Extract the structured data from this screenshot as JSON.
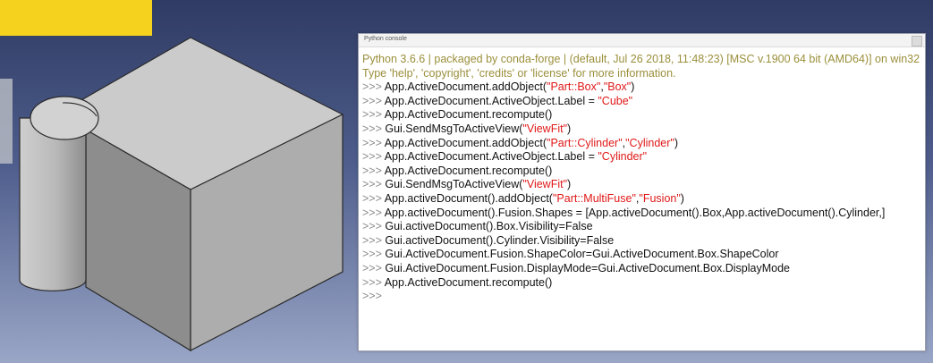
{
  "console": {
    "title": "Python console",
    "lines": [
      {
        "kind": "sys",
        "text": "Python 3.6.6 | packaged by conda-forge | (default, Jul 26 2018, 11:48:23) [MSC v.1900 64 bit (AMD64)] on win32"
      },
      {
        "kind": "sys",
        "text": "Type 'help', 'copyright', 'credits' or 'license' for more information."
      },
      {
        "kind": "cmd",
        "parts": [
          {
            "t": "code",
            "v": "App.ActiveDocument.addObject("
          },
          {
            "t": "str",
            "v": "\"Part::Box\""
          },
          {
            "t": "code",
            "v": ","
          },
          {
            "t": "str",
            "v": "\"Box\""
          },
          {
            "t": "code",
            "v": ")"
          }
        ]
      },
      {
        "kind": "cmd",
        "parts": [
          {
            "t": "code",
            "v": "App.ActiveDocument.ActiveObject.Label = "
          },
          {
            "t": "str",
            "v": "\"Cube\""
          }
        ]
      },
      {
        "kind": "cmd",
        "parts": [
          {
            "t": "code",
            "v": "App.ActiveDocument.recompute()"
          }
        ]
      },
      {
        "kind": "cmd",
        "parts": [
          {
            "t": "code",
            "v": "Gui.SendMsgToActiveView("
          },
          {
            "t": "str",
            "v": "\"ViewFit\""
          },
          {
            "t": "code",
            "v": ")"
          }
        ]
      },
      {
        "kind": "cmd",
        "parts": [
          {
            "t": "code",
            "v": "App.ActiveDocument.addObject("
          },
          {
            "t": "str",
            "v": "\"Part::Cylinder\""
          },
          {
            "t": "code",
            "v": ","
          },
          {
            "t": "str",
            "v": "\"Cylinder\""
          },
          {
            "t": "code",
            "v": ")"
          }
        ]
      },
      {
        "kind": "cmd",
        "parts": [
          {
            "t": "code",
            "v": "App.ActiveDocument.ActiveObject.Label = "
          },
          {
            "t": "str",
            "v": "\"Cylinder\""
          }
        ]
      },
      {
        "kind": "cmd",
        "parts": [
          {
            "t": "code",
            "v": "App.ActiveDocument.recompute()"
          }
        ]
      },
      {
        "kind": "cmd",
        "parts": [
          {
            "t": "code",
            "v": "Gui.SendMsgToActiveView("
          },
          {
            "t": "str",
            "v": "\"ViewFit\""
          },
          {
            "t": "code",
            "v": ")"
          }
        ]
      },
      {
        "kind": "cmd",
        "parts": [
          {
            "t": "code",
            "v": "App.activeDocument().addObject("
          },
          {
            "t": "str",
            "v": "\"Part::MultiFuse\""
          },
          {
            "t": "code",
            "v": ","
          },
          {
            "t": "str",
            "v": "\"Fusion\""
          },
          {
            "t": "code",
            "v": ")"
          }
        ]
      },
      {
        "kind": "cmd",
        "parts": [
          {
            "t": "code",
            "v": "App.activeDocument().Fusion.Shapes = [App.activeDocument().Box,App.activeDocument().Cylinder,]"
          }
        ]
      },
      {
        "kind": "cmd",
        "parts": [
          {
            "t": "code",
            "v": "Gui.activeDocument().Box.Visibility=False"
          }
        ]
      },
      {
        "kind": "cmd",
        "parts": [
          {
            "t": "code",
            "v": "Gui.activeDocument().Cylinder.Visibility=False"
          }
        ]
      },
      {
        "kind": "cmd",
        "parts": [
          {
            "t": "code",
            "v": "Gui.ActiveDocument.Fusion.ShapeColor=Gui.ActiveDocument.Box.ShapeColor"
          }
        ]
      },
      {
        "kind": "cmd",
        "parts": [
          {
            "t": "code",
            "v": "Gui.ActiveDocument.Fusion.DisplayMode=Gui.ActiveDocument.Box.DisplayMode"
          }
        ]
      },
      {
        "kind": "cmd",
        "parts": [
          {
            "t": "code",
            "v": "App.ActiveDocument.recompute()"
          }
        ]
      },
      {
        "kind": "cmd",
        "parts": []
      }
    ],
    "prompt": ">>> "
  },
  "viewport": {
    "background_top": "#2f3b63",
    "background_bottom": "#9aa6c6",
    "model": "cube-cylinder-fusion"
  }
}
